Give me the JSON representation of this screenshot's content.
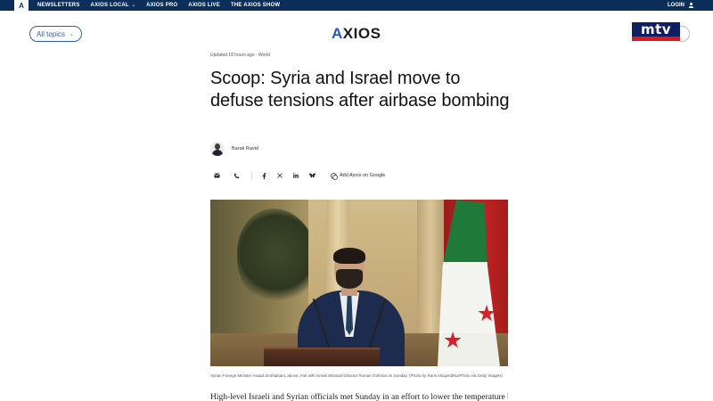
{
  "topbar": {
    "logo": "A",
    "nav": [
      {
        "label": "NEWSLETTERS",
        "dropdown": false
      },
      {
        "label": "AXIOS LOCAL",
        "dropdown": true
      },
      {
        "label": "AXIOS PRO",
        "dropdown": false
      },
      {
        "label": "AXIOS LIVE",
        "dropdown": false
      },
      {
        "label": "THE AXIOS SHOW",
        "dropdown": false
      }
    ],
    "login_label": "LOGIN"
  },
  "header": {
    "topics_label": "All topics",
    "brand_mark": "A",
    "brand_rest": "XIOS",
    "overlay_logo": "mtv"
  },
  "article": {
    "updated": "Updated 18 hours ago - World",
    "headline": "Scoop: Syria and Israel move to defuse tensions after airbase bombing",
    "author": "Barak Ravid",
    "add_google_label": "Add Axios on Google",
    "caption": "Syrian Foreign Minister Asaad al-Shaibani, above, met with Israeli Mossad Director Roman Gofman on Sunday. (Photo by Rami Alsayed/NurPhoto via Getty Images)",
    "body_first_line": "High-level Israeli and Syrian officials met Sunday in an effort to lower the temperature between"
  },
  "share": {
    "icons": [
      "email-icon",
      "phone-icon",
      "facebook-icon",
      "x-icon",
      "linkedin-icon",
      "bluesky-icon"
    ]
  },
  "colors": {
    "topbar": "#0b2e5b",
    "accent": "#2f5fb3",
    "mtv_blue": "#0d1e62",
    "mtv_red": "#d91a21"
  }
}
